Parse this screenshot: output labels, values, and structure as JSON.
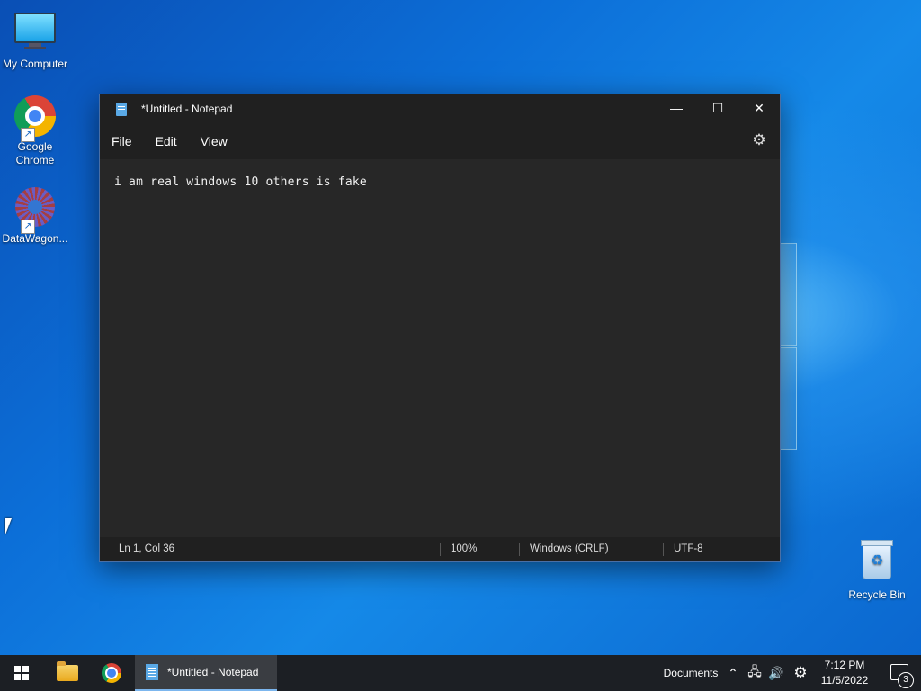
{
  "desktop": {
    "icons": [
      {
        "label": "My Computer",
        "icon": "monitor-icon"
      },
      {
        "label": "Google\nChrome",
        "icon": "chrome-icon"
      },
      {
        "label": "DataWagon...",
        "icon": "datawagon-icon"
      },
      {
        "label": "Recycle Bin",
        "icon": "recycle-bin-icon"
      }
    ]
  },
  "notepad": {
    "title": "*Untitled - Notepad",
    "menu": [
      "File",
      "Edit",
      "View"
    ],
    "content": "i am real windows 10 others is fake",
    "status": {
      "position": "Ln 1, Col 36",
      "zoom": "100%",
      "line_endings": "Windows (CRLF)",
      "encoding": "UTF-8"
    },
    "caption_buttons": {
      "minimize": "—",
      "maximize": "☐",
      "close": "✕"
    }
  },
  "taskbar": {
    "active_app": "*Untitled - Notepad",
    "tray_label": "Documents",
    "time": "7:12 PM",
    "date": "11/5/2022",
    "notification_count": "3"
  }
}
